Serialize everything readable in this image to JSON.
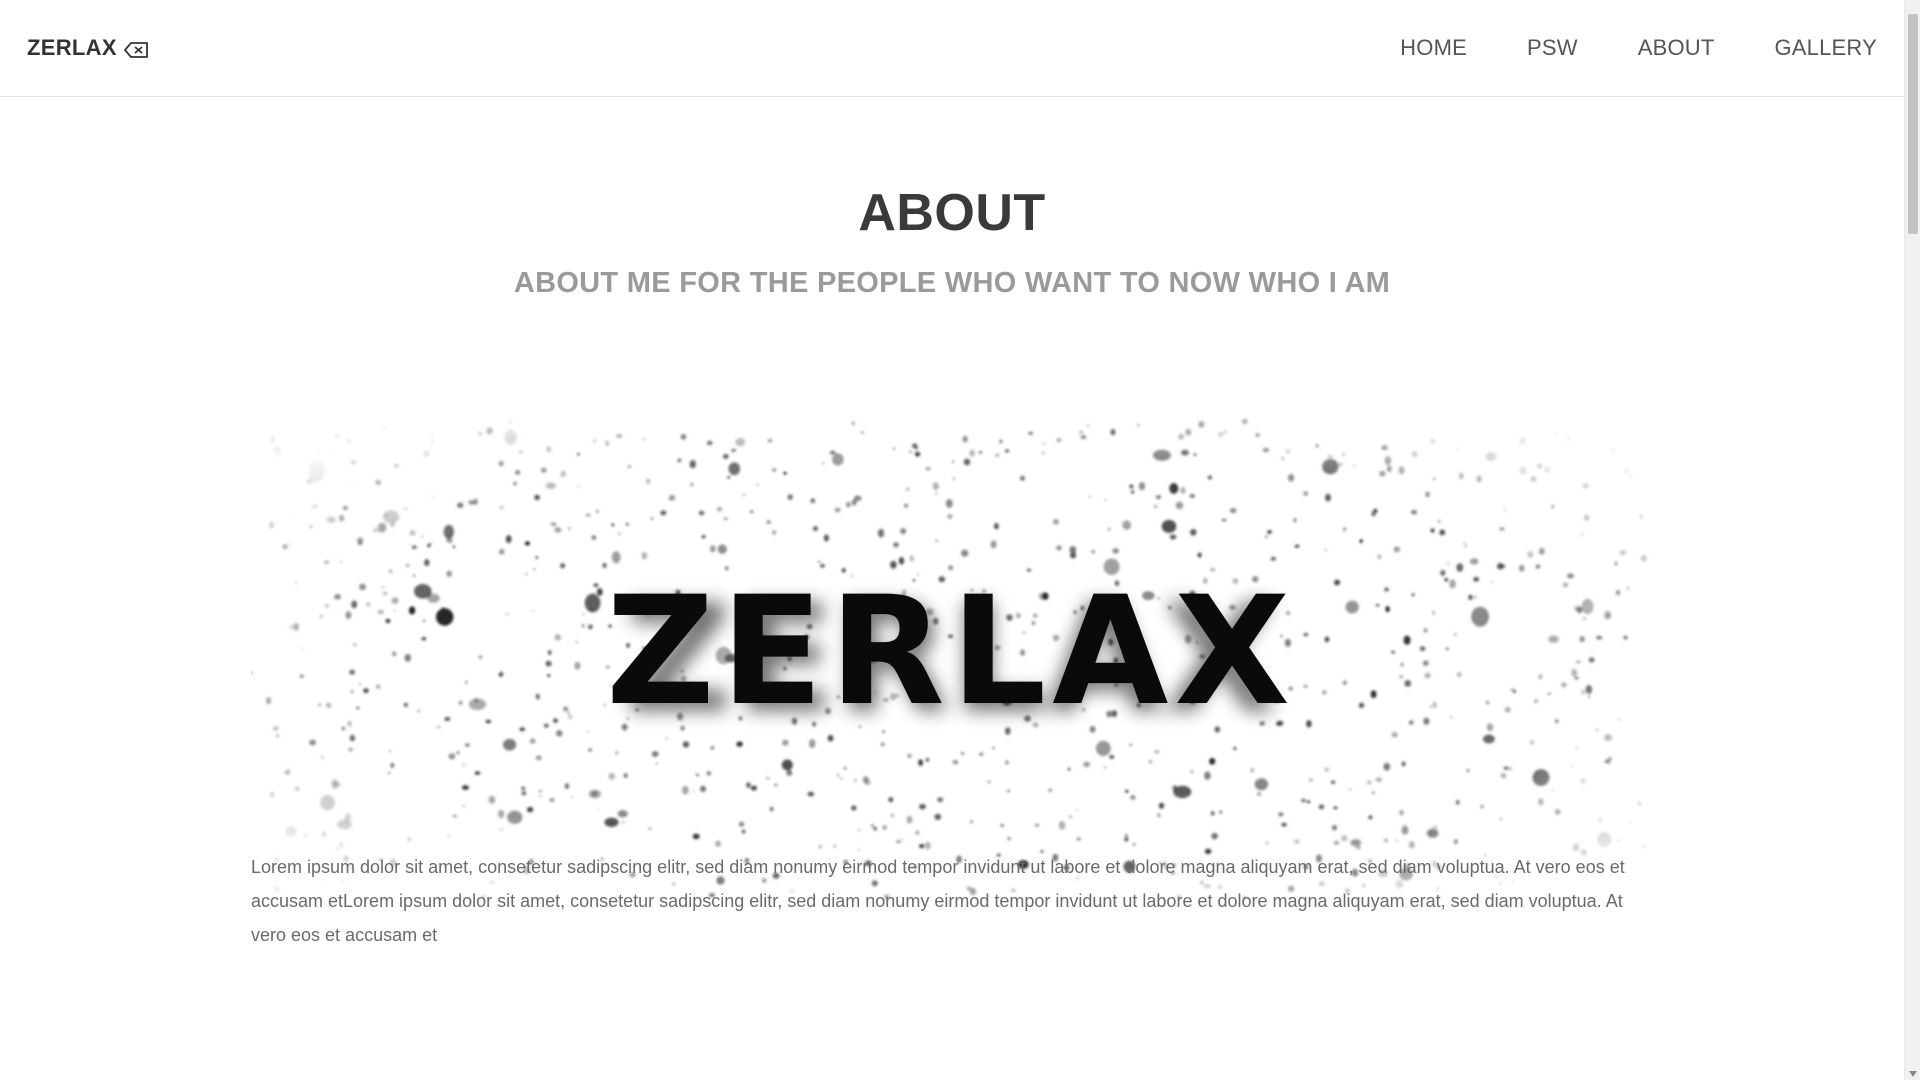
{
  "brand": {
    "name": "ZERLAX",
    "icon": "backspace-icon"
  },
  "nav": {
    "items": [
      {
        "label": "HOME"
      },
      {
        "label": "PSW"
      },
      {
        "label": "ABOUT"
      },
      {
        "label": "GALLERY"
      }
    ]
  },
  "main": {
    "title": "ABOUT",
    "subtitle": "ABOUT ME FOR THE PEOPLE WHO WANT TO NOW WHO I AM",
    "hero_text": "ZERLAX",
    "paragraph": "Lorem ipsum dolor sit amet, consetetur sadipscing elitr, sed diam nonumy eirmod tempor invidunt ut labore et dolore magna aliquyam erat, sed diam voluptua. At vero eos et accusam etLorem ipsum dolor sit amet, consetetur sadipscing elitr, sed diam nonumy eirmod tempor invidunt ut labore et dolore magna aliquyam erat, sed diam voluptua. At vero eos et accusam et"
  }
}
